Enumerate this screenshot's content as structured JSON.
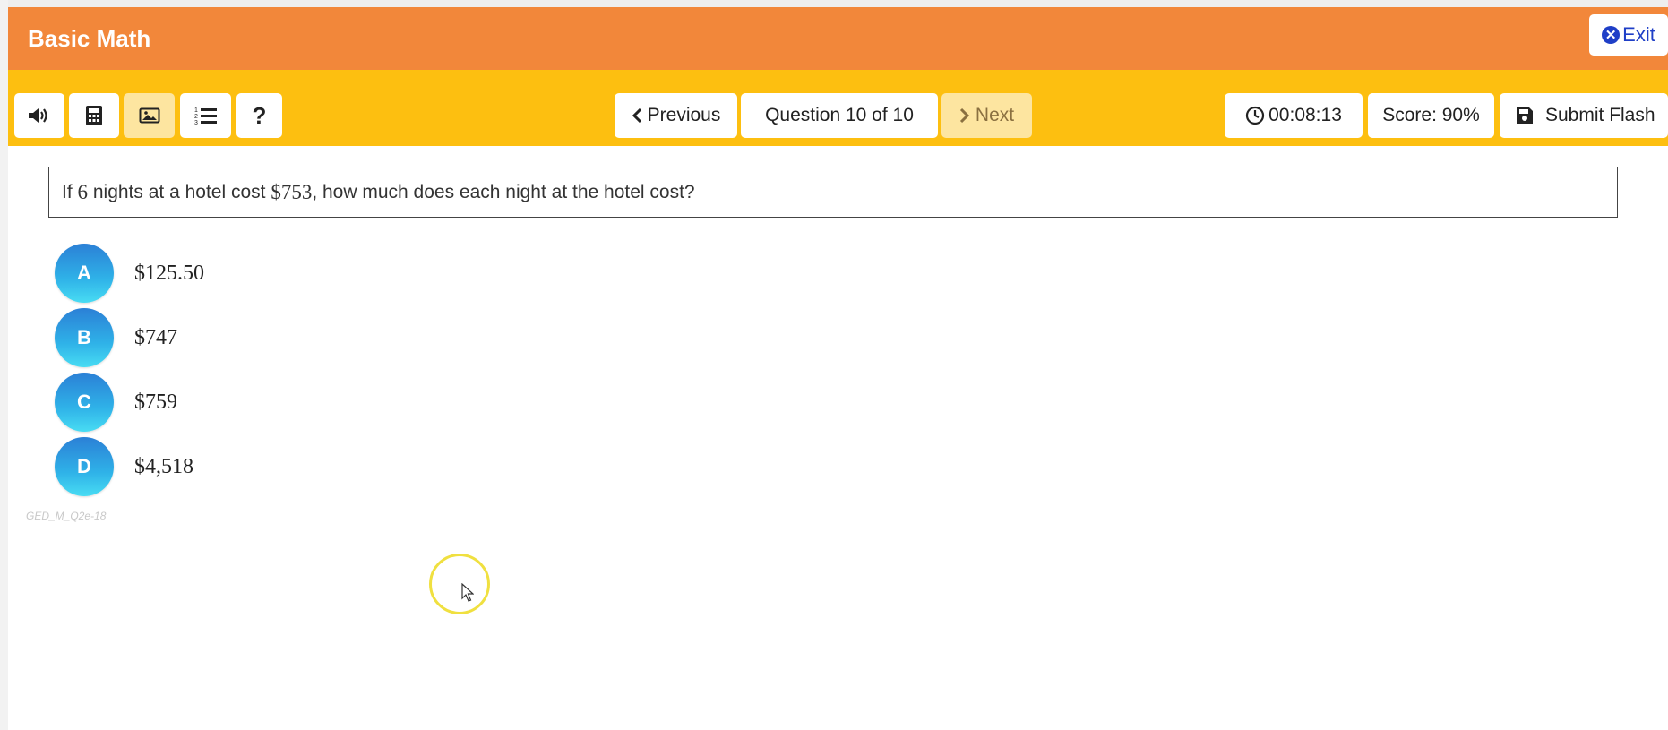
{
  "app": {
    "title": "Basic Math",
    "exit_label": "Exit"
  },
  "toolbar": {
    "tools": [
      {
        "name": "audio",
        "icon": "speaker-icon"
      },
      {
        "name": "calculator",
        "icon": "calculator-icon"
      },
      {
        "name": "image",
        "icon": "image-icon",
        "active": true
      },
      {
        "name": "list",
        "icon": "numbered-list-icon"
      },
      {
        "name": "help",
        "icon": "question-icon"
      }
    ],
    "previous_label": "Previous",
    "question_counter": "Question 10 of 10",
    "next_label": "Next",
    "timer": "00:08:13",
    "score": "Score: 90%",
    "submit_label": "Submit Flash"
  },
  "question": {
    "pre": "If ",
    "nights": "6",
    "mid": " nights at a hotel cost ",
    "cost": "$753",
    "post": ", how much does each night at the hotel cost?"
  },
  "choices": [
    {
      "letter": "A",
      "text": "$125.50"
    },
    {
      "letter": "B",
      "text": "$747"
    },
    {
      "letter": "C",
      "text": "$759"
    },
    {
      "letter": "D",
      "text": "$4,518"
    }
  ],
  "question_id": "GED_M_Q2e-18",
  "colors": {
    "header": "#f2873a",
    "toolbar": "#fdbf10",
    "choice_bubble": "#2fb2e8",
    "exit_text": "#1f3fc7"
  }
}
